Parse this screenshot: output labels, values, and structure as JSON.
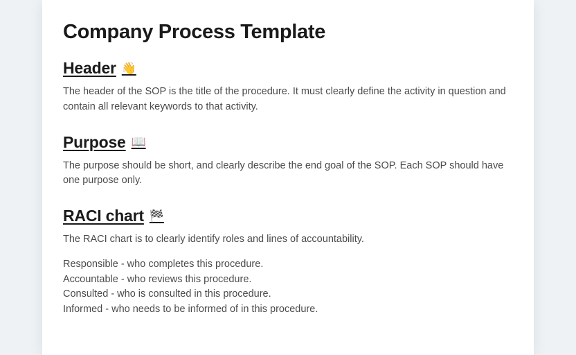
{
  "title": "Company Process Template",
  "sections": {
    "header": {
      "heading": "Header",
      "emoji": "👋",
      "body": "The header of the SOP is the title of the procedure. It must clearly define the activity in question and contain all relevant keywords to that activity."
    },
    "purpose": {
      "heading": "Purpose",
      "emoji": "📖",
      "body": "The purpose should be short, and clearly describe the end goal of the SOP. Each SOP should have one purpose only."
    },
    "raci": {
      "heading": "RACI chart",
      "emoji": "🏁",
      "intro": "The RACI chart is to clearly identify roles and lines of accountability.",
      "lines": {
        "responsible": "Responsible - who completes this procedure.",
        "accountable": "Accountable - who reviews this procedure.",
        "consulted": "Consulted - who is consulted in this procedure.",
        "informed": "Informed - who needs to be informed of in this procedure."
      }
    }
  }
}
